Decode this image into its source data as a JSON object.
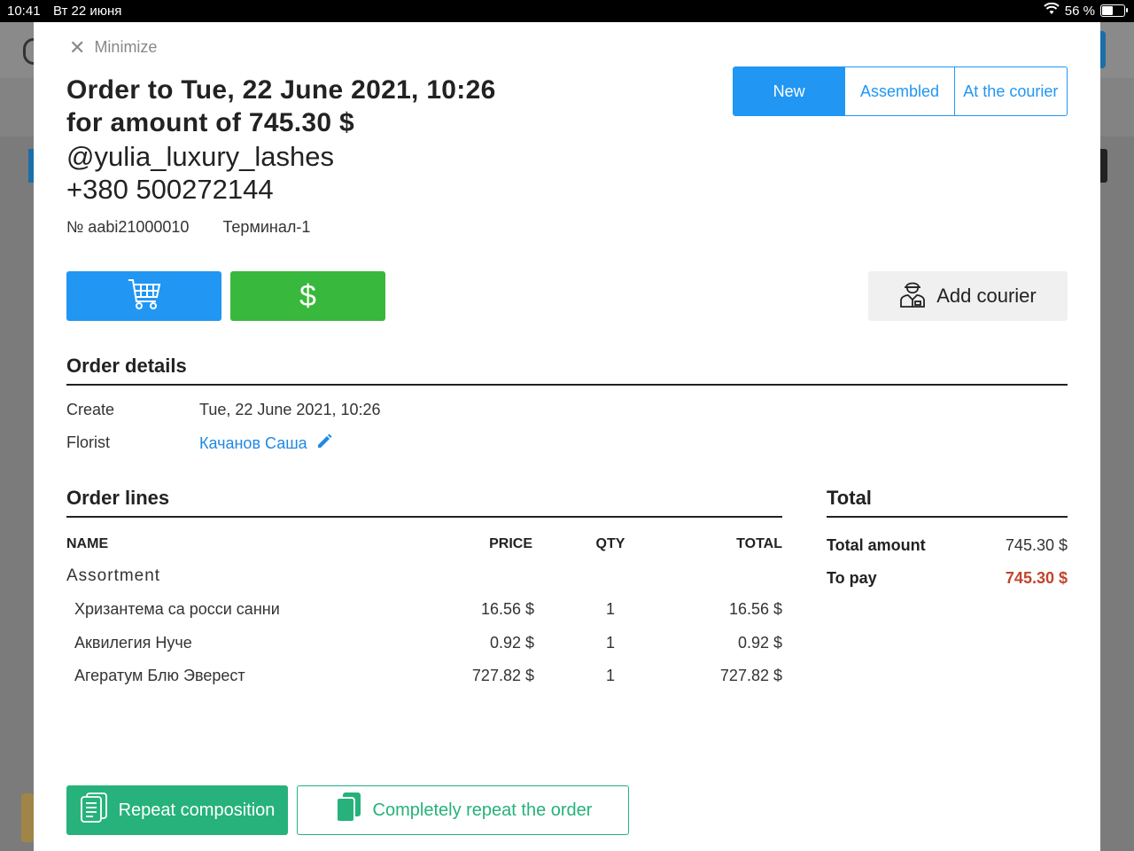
{
  "status_bar": {
    "time": "10:41",
    "date": "Вт 22 июня",
    "battery": "56 %",
    "battery_level": 0.56
  },
  "modal": {
    "minimize_label": "Minimize",
    "title_line1": "Order to Tue, 22 June 2021, 10:26",
    "title_line2": "for amount of 745.30 $",
    "customer_handle": "@yulia_luxury_lashes",
    "customer_phone": "+380 500272144",
    "order_number": "№ aabi21000010",
    "terminal": "Терминал-1",
    "status_tabs": [
      {
        "label": "New",
        "active": true
      },
      {
        "label": "Assembled",
        "active": false
      },
      {
        "label": "At the courier",
        "active": false
      }
    ],
    "actions": {
      "cart_icon": "cart-icon",
      "payment_symbol": "$",
      "add_courier_label": "Add courier"
    },
    "order_details": {
      "heading": "Order details",
      "create_label": "Create",
      "create_value": "Tue, 22 June 2021, 10:26",
      "florist_label": "Florist",
      "florist_value": "Качанов Саша"
    },
    "order_lines": {
      "heading": "Order lines",
      "columns": {
        "name": "NAME",
        "price": "PRICE",
        "qty": "QTY",
        "total": "TOTAL"
      },
      "group": "Assortment",
      "rows": [
        {
          "name": "Хризантема са росси санни",
          "price": "16.56 $",
          "qty": "1",
          "total": "16.56 $"
        },
        {
          "name": "Аквилегия Нуче",
          "price": "0.92 $",
          "qty": "1",
          "total": "0.92 $"
        },
        {
          "name": "Агератум Блю Эверест",
          "price": "727.82 $",
          "qty": "1",
          "total": "727.82 $"
        }
      ]
    },
    "totals": {
      "heading": "Total",
      "total_amount_label": "Total amount",
      "total_amount_value": "745.30 $",
      "to_pay_label": "To pay",
      "to_pay_value": "745.30 $"
    },
    "bottom_buttons": {
      "repeat_composition": "Repeat composition",
      "repeat_order": "Completely repeat the order"
    }
  },
  "colors": {
    "primary_blue": "#2196f3",
    "green": "#38b83c",
    "teal_green": "#26b27a",
    "pay_red": "#c2452d"
  }
}
